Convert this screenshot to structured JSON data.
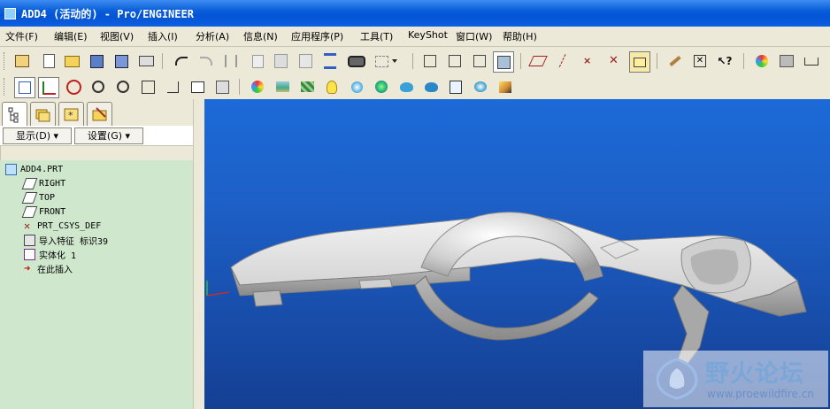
{
  "window": {
    "title": "ADD4 (活动的) - Pro/ENGINEER"
  },
  "menu": {
    "items": [
      "文件(F)",
      "编辑(E)",
      "视图(V)",
      "插入(I)",
      "分析(A)",
      "信息(N)",
      "应用程序(P)",
      "工具(T)",
      "KeyShot",
      "窗口(W)",
      "帮助(H)"
    ]
  },
  "toolbar": {
    "row1_icons": [
      "select-filter-icon",
      "new-icon",
      "open-icon",
      "save-icon",
      "save-copy-icon",
      "print-icon",
      "undo-icon",
      "redo-icon",
      "cut-icon",
      "copy-icon",
      "paste-icon",
      "paste-special-icon",
      "regenerate-icon",
      "find-icon",
      "select-box-icon",
      "dropdown-icon",
      "wireframe-icon",
      "hidden-line-icon",
      "no-hidden-icon",
      "shading-icon",
      "datum-plane-icon",
      "datum-axis-icon",
      "datum-point-icon",
      "coordinate-system-icon",
      "annotation-icon",
      "sketch-icon",
      "close-window-icon",
      "whats-this-icon",
      "color-icon",
      "material-icon",
      "measure-icon"
    ],
    "row2_icons": [
      "sketcher-icon",
      "datum-display-icon",
      "spin-center-icon",
      "zoom-in-icon",
      "zoom-out-icon",
      "refit-icon",
      "orient-icon",
      "saved-views-icon",
      "layers-icon",
      "appearance-icon",
      "scene-icon",
      "texture-icon",
      "light-icon",
      "render-room-icon",
      "environment-icon",
      "keyshot-icon",
      "render-icon",
      "render-region-icon",
      "photo-icon",
      "settings-icon"
    ]
  },
  "nav_tabs": [
    "model-tree-tab",
    "folder-browser-tab",
    "favorites-tab",
    "connections-tab"
  ],
  "panel": {
    "show_label": "显示(D)",
    "settings_label": "设置(G)"
  },
  "tree": {
    "items": [
      {
        "label": "ADD4.PRT",
        "icon": "part-icon"
      },
      {
        "label": "RIGHT",
        "icon": "datum-plane-icon"
      },
      {
        "label": "TOP",
        "icon": "datum-plane-icon"
      },
      {
        "label": "FRONT",
        "icon": "datum-plane-icon"
      },
      {
        "label": "PRT_CSYS_DEF",
        "icon": "csys-icon"
      },
      {
        "label": "导入特征 标识39",
        "icon": "import-feature-icon"
      },
      {
        "label": "实体化 1",
        "icon": "solidify-icon"
      },
      {
        "label": "在此插入",
        "icon": "insert-here-arrow-icon"
      }
    ]
  },
  "watermark": {
    "text": "野火论坛",
    "url": "www.proewildfire.cn"
  },
  "colors": {
    "titlebar": "#0a5ed8",
    "viewport_top": "#1c6ad8",
    "viewport_bottom": "#143f93",
    "tree_bg": "#cfe8cd"
  }
}
